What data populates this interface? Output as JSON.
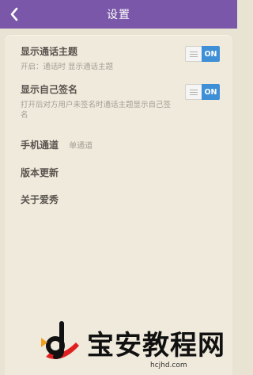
{
  "header": {
    "title": "设置"
  },
  "settings": [
    {
      "label": "显示通话主题",
      "sub": "开启：通话时 显示通话主题",
      "toggle": "ON"
    },
    {
      "label": "显示自己签名",
      "sub": "打开后对方用户未签名时通话主题显示自己签名",
      "toggle": "ON"
    },
    {
      "label": "手机通道",
      "value": "单通道"
    },
    {
      "label": "版本更新"
    },
    {
      "label": "关于爱秀"
    }
  ],
  "watermark": {
    "text": "宝安教程网",
    "url": "hcjhd.com"
  },
  "colors": {
    "titlebar": "#7a57a8",
    "toggle_on": "#3e8fd6",
    "watermark_logo": "#e02020"
  }
}
